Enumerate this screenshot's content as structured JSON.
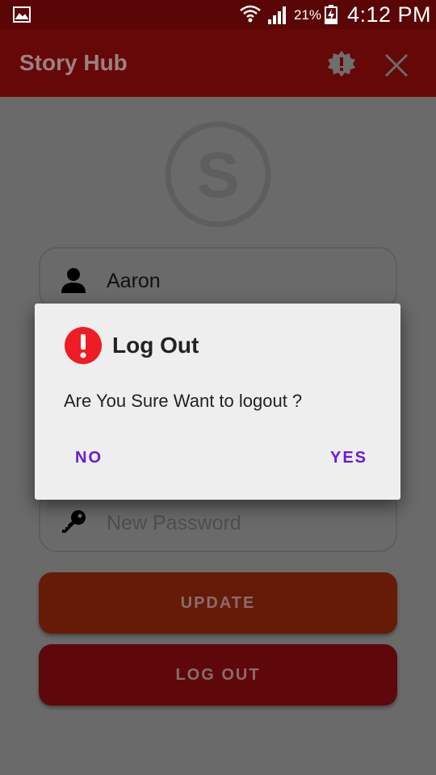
{
  "status_bar": {
    "battery_percent": "21%",
    "time": "4:12 PM"
  },
  "app_bar": {
    "title": "Story Hub",
    "settings_icon": "gear-icon",
    "close_icon": "close-icon"
  },
  "logo": {
    "letter": "S"
  },
  "form": {
    "username_value": "Aaron",
    "new_password_placeholder": "New Password",
    "update_label": "UPDATE",
    "logout_label": "LOG OUT"
  },
  "dialog": {
    "title": "Log Out",
    "message": "Are You Sure Want to logout ?",
    "no_label": "NO",
    "yes_label": "YES",
    "icon": "alert-icon",
    "accent_color": "#6a1bd8",
    "icon_color": "#ee1c24"
  },
  "colors": {
    "app_bar": "#660808",
    "status_bar": "#5a0606",
    "update_button": "#661b06",
    "logout_button": "#5e080b",
    "scrim": "#6a6a6a"
  }
}
